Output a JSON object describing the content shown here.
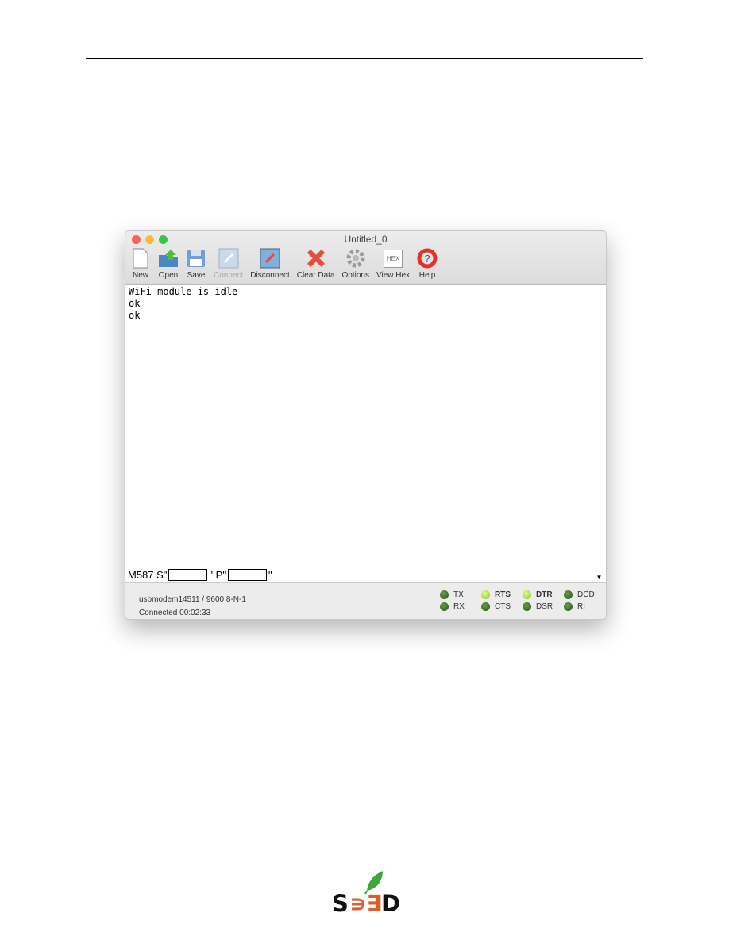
{
  "window": {
    "title": "Untitled_0"
  },
  "toolbar": [
    {
      "label": "New",
      "icon": "new-document-icon",
      "enabled": true
    },
    {
      "label": "Open",
      "icon": "open-folder-icon",
      "enabled": true
    },
    {
      "label": "Save",
      "icon": "floppy-disk-icon",
      "enabled": true
    },
    {
      "label": "Connect",
      "icon": "plug-icon",
      "enabled": false
    },
    {
      "label": "Disconnect",
      "icon": "unplug-icon",
      "enabled": true
    },
    {
      "label": "Clear Data",
      "icon": "red-x-icon",
      "enabled": true
    },
    {
      "label": "Options",
      "icon": "gears-icon",
      "enabled": true
    },
    {
      "label": "View Hex",
      "icon": "hex-icon",
      "enabled": true
    },
    {
      "label": "Help",
      "icon": "lifebuoy-icon",
      "enabled": true
    }
  ],
  "hex_text": "HEX",
  "terminal": {
    "lines": [
      "WiFi module is idle",
      "ok",
      "ok"
    ]
  },
  "input": {
    "prefix": "M587 S\"",
    "middle": "\" P\"",
    "suffix": "\""
  },
  "status": {
    "port": "usbmodem14511 / 9600 8-N-1",
    "connection": "Connected 00:02:33"
  },
  "leds": {
    "txrx": [
      {
        "label": "TX",
        "on": false
      },
      {
        "label": "RX",
        "on": false
      }
    ],
    "lines": [
      {
        "label": "RTS",
        "on": true
      },
      {
        "label": "DTR",
        "on": true
      },
      {
        "label": "DCD",
        "on": false
      },
      {
        "label": "CTS",
        "on": false
      },
      {
        "label": "DSR",
        "on": false
      },
      {
        "label": "RI",
        "on": false
      }
    ]
  },
  "logo": {
    "text": "SEED"
  }
}
